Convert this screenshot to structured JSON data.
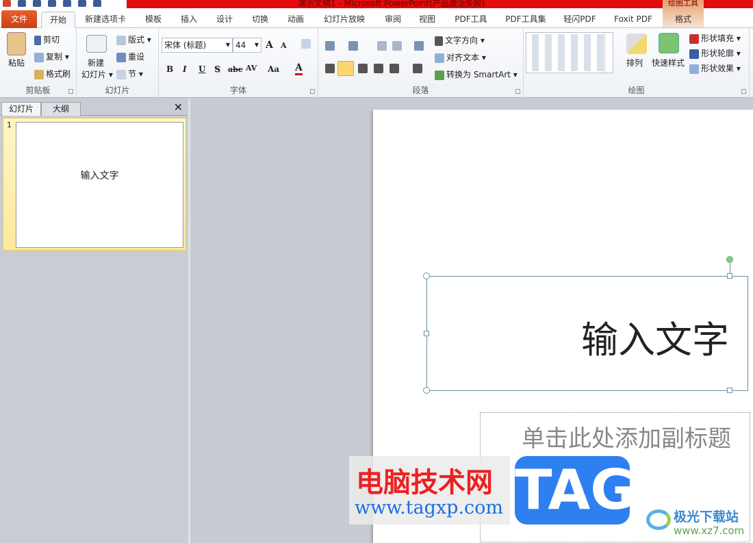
{
  "window": {
    "title": "演示文稿1 - Microsoft PowerPoint(产品激活失败)",
    "context_tab_group": "绘图工具"
  },
  "tabs": [
    "文件",
    "开始",
    "新建选项卡",
    "模板",
    "插入",
    "设计",
    "切换",
    "动画",
    "幻灯片放映",
    "审阅",
    "视图",
    "PDF工具",
    "PDF工具集",
    "轻闪PDF",
    "Foxit PDF",
    "格式"
  ],
  "ribbon": {
    "clipboard": {
      "label": "剪贴板",
      "paste": "粘贴",
      "cut": "剪切",
      "copy": "复制",
      "format_painter": "格式刷"
    },
    "slides": {
      "label": "幻灯片",
      "new_slide_1": "新建",
      "new_slide_2": "幻灯片",
      "layout": "版式",
      "reset": "重设",
      "section": "节"
    },
    "font": {
      "label": "字体",
      "font_name": "宋体 (标题)",
      "font_size": "44",
      "bold": "B",
      "italic": "I",
      "underline": "U",
      "shadow": "S",
      "strike": "abc",
      "spacing": "AV",
      "case": "Aa",
      "color": "A",
      "grow": "A",
      "shrink": "A"
    },
    "paragraph": {
      "label": "段落",
      "text_direction": "文字方向",
      "align_text": "对齐文本",
      "smartart": "转换为 SmartArt"
    },
    "drawing": {
      "label": "绘图",
      "arrange": "排列",
      "quick_styles": "快速样式",
      "shape_fill": "形状填充",
      "shape_outline": "形状轮廓",
      "shape_effects": "形状效果"
    }
  },
  "left_pane": {
    "tabs": [
      "幻灯片",
      "大纲"
    ],
    "slide_number": "1",
    "thumb_text": "输入文字"
  },
  "slide": {
    "title": "输入文字",
    "subtitle_placeholder": "单击此处添加副标题"
  },
  "watermarks": {
    "site_name": "电脑技术网",
    "site_url": "www.tagxp.com",
    "tag": "TAG",
    "xz_name": "极光下载站",
    "xz_url": "www.xz7.com"
  }
}
